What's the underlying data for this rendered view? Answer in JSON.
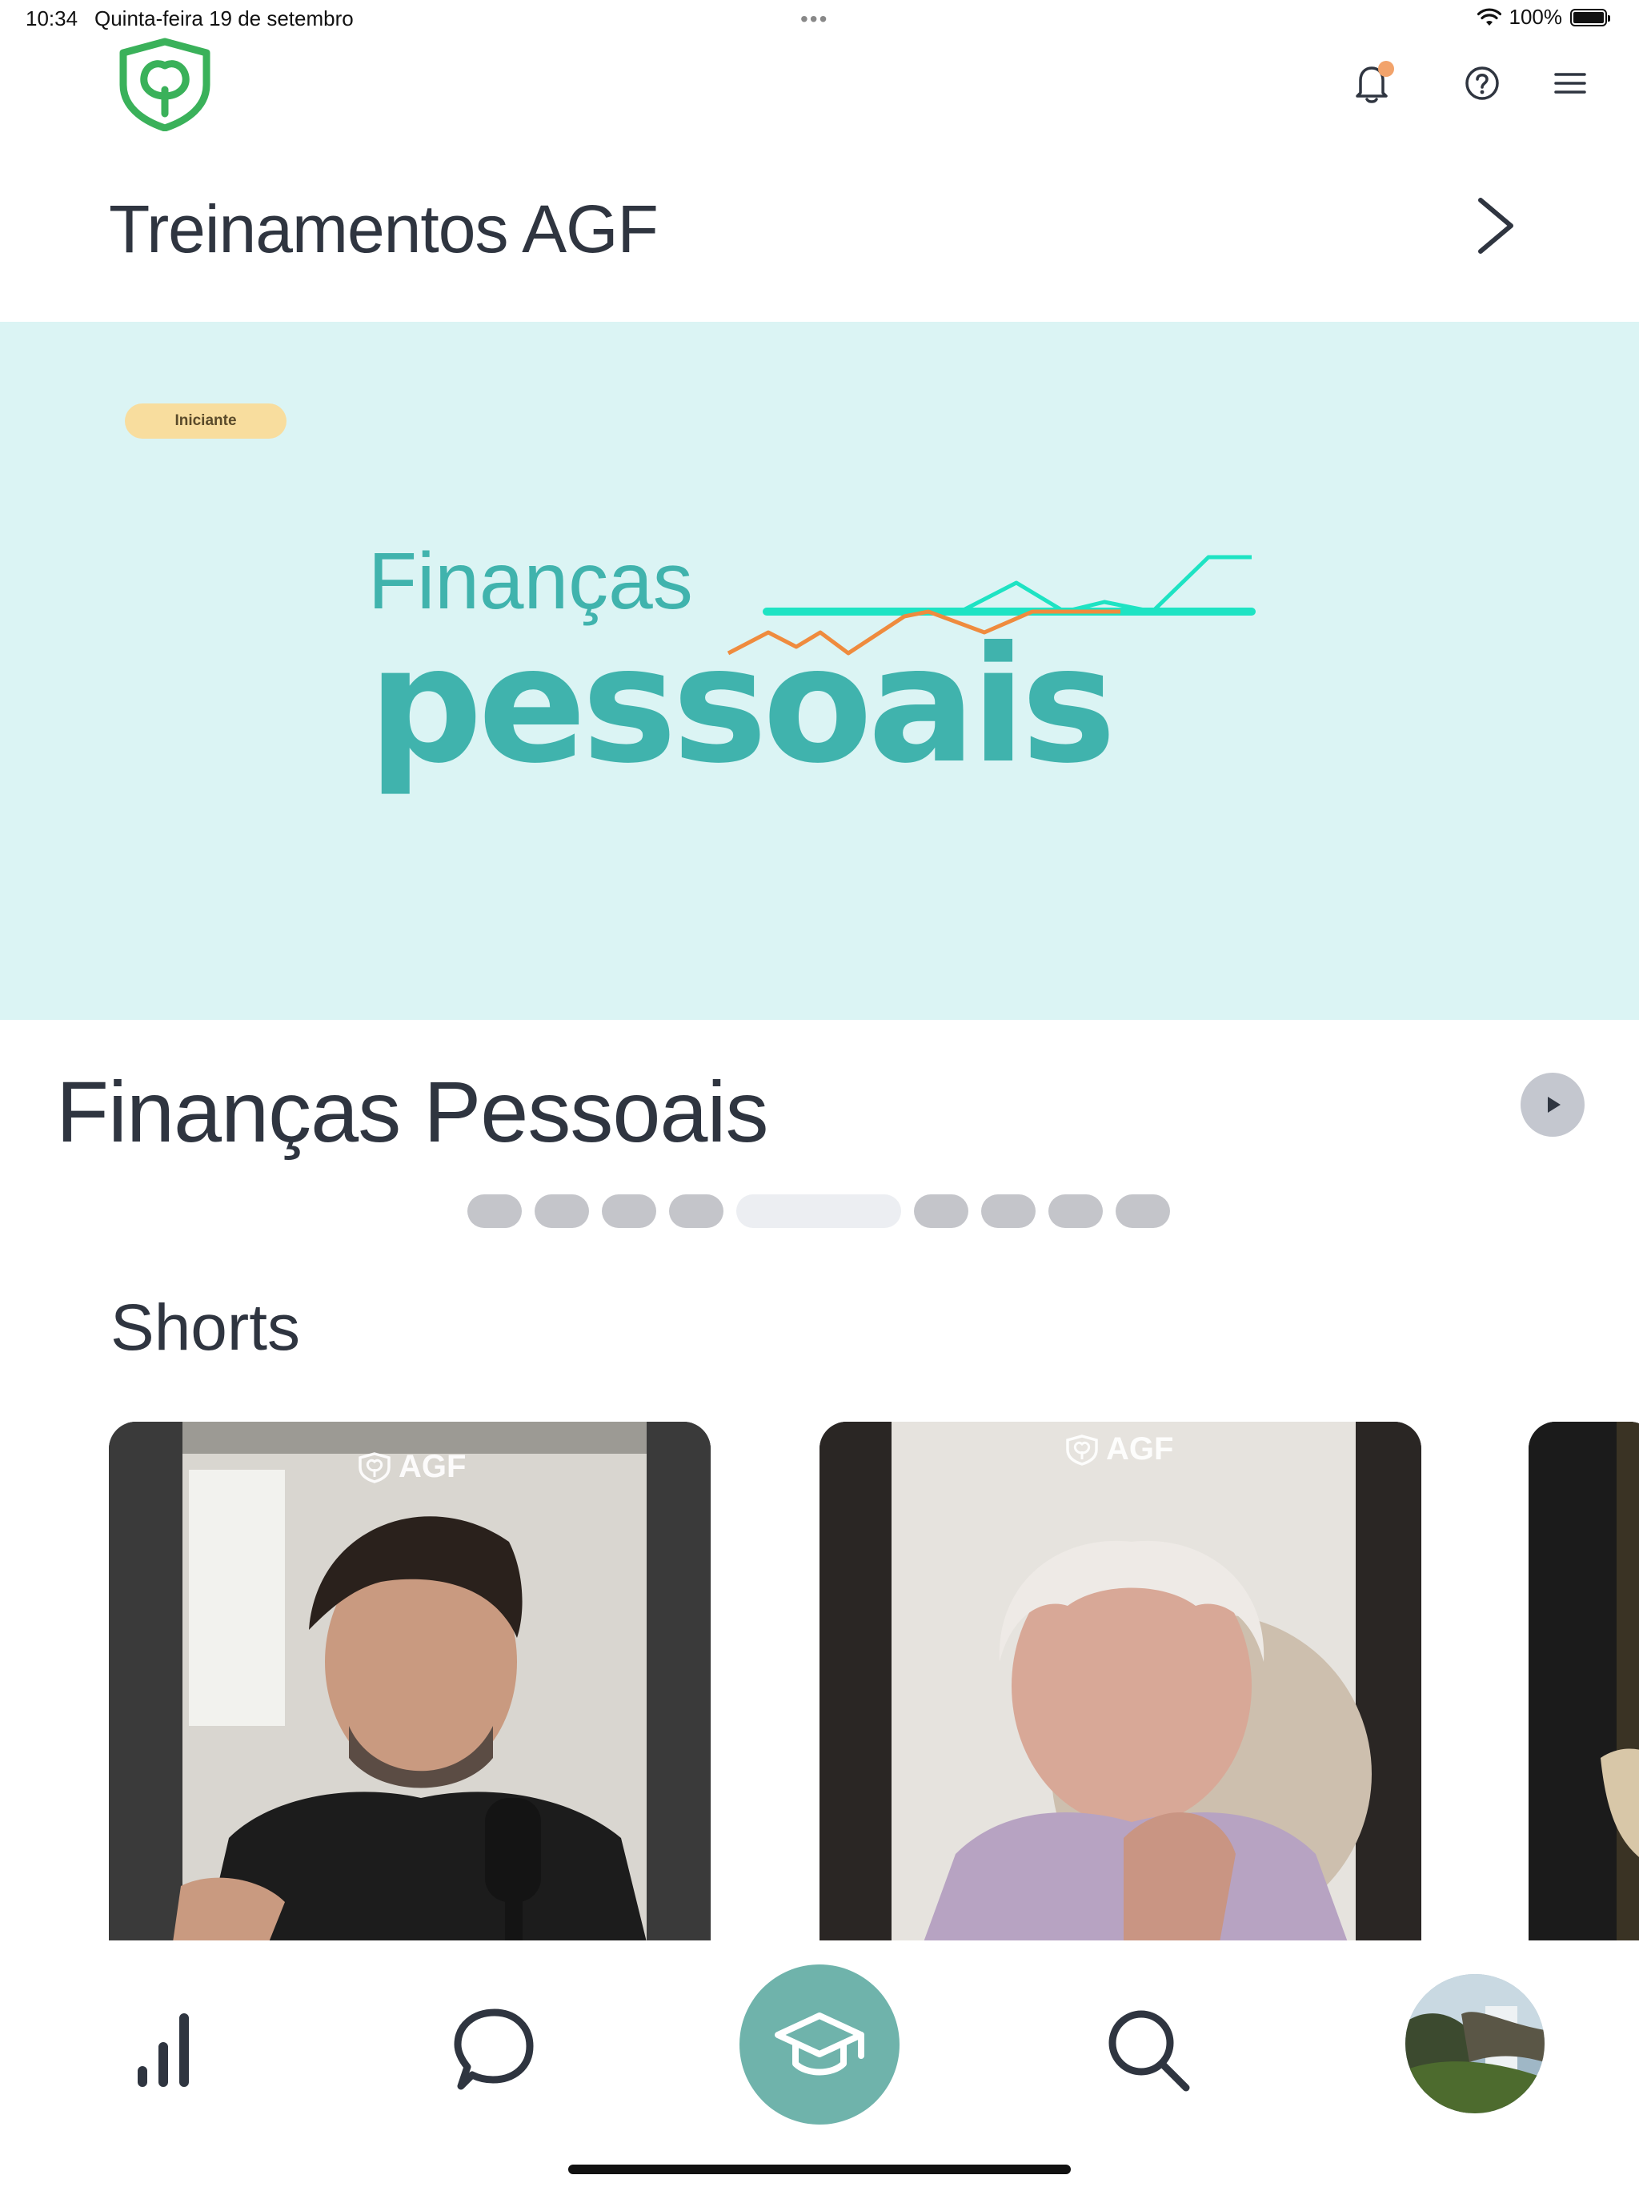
{
  "status_bar": {
    "time": "10:34",
    "date": "Quinta-feira 19 de setembro",
    "more": "•••",
    "battery": "100%"
  },
  "header": {
    "section_title": "Treinamentos AGF",
    "icons": [
      "logo-icon",
      "bell-icon",
      "help-icon",
      "menu-icon",
      "chevron-right-icon"
    ]
  },
  "hero": {
    "badge": "Iniciante",
    "art_line1": "Finanças",
    "art_line2": "pessoais",
    "background": "#dbf4f4",
    "accent": "#40b3ad"
  },
  "course": {
    "title": "Finanças Pessoais",
    "pager": {
      "count": 9,
      "active_index": 4
    }
  },
  "shorts": {
    "title": "Shorts",
    "cards": [
      {
        "brand": "AGF"
      },
      {
        "brand": "AGF"
      },
      {
        "brand": ""
      }
    ]
  },
  "tab_bar": {
    "items": [
      "stats-icon",
      "chat-icon",
      "graduation-cap-icon",
      "search-icon",
      "profile-avatar"
    ],
    "active": "graduation-cap-icon",
    "active_color": "#6fb3ab"
  }
}
